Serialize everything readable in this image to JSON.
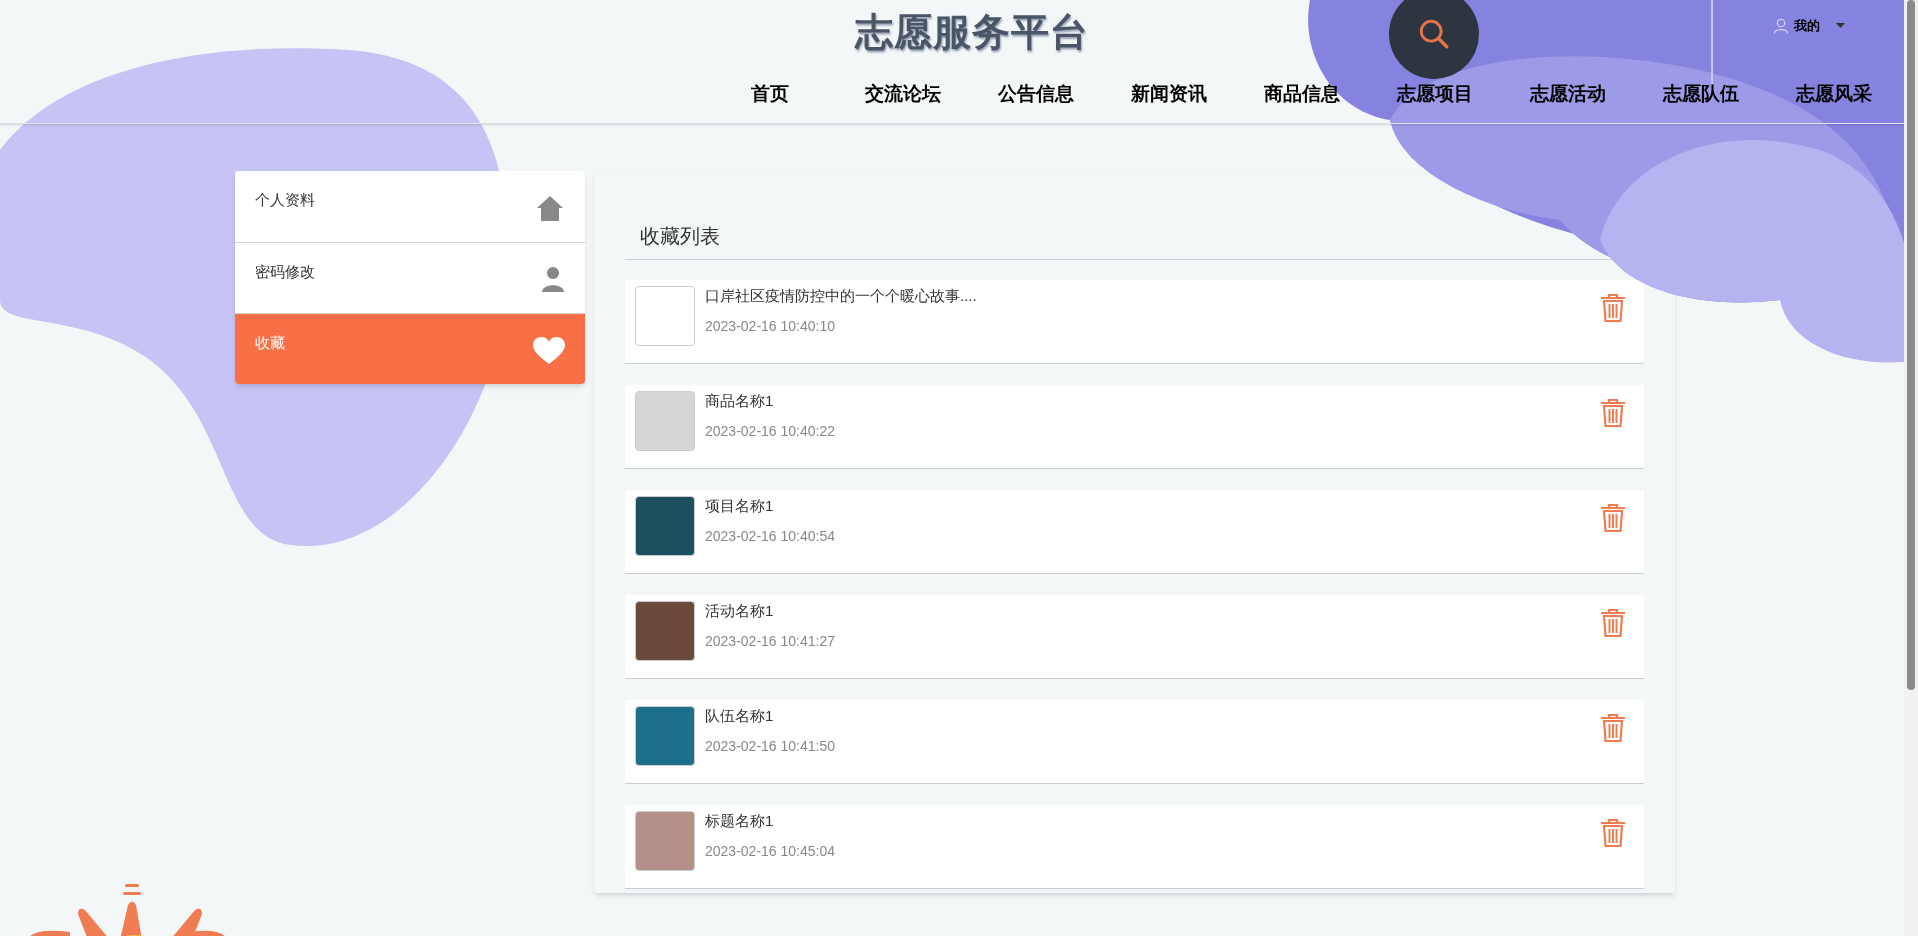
{
  "header": {
    "title": "志愿服务平台",
    "user_menu": "我的",
    "nav": [
      {
        "label": "首页",
        "selected": false
      },
      {
        "label": "交流论坛",
        "selected": false
      },
      {
        "label": "公告信息",
        "selected": false
      },
      {
        "label": "新闻资讯",
        "selected": false
      },
      {
        "label": "商品信息",
        "selected": false
      },
      {
        "label": "志愿项目",
        "selected": false
      },
      {
        "label": "志愿活动",
        "selected": false
      },
      {
        "label": "志愿队伍",
        "selected": false
      },
      {
        "label": "志愿风采",
        "selected": false
      }
    ]
  },
  "sidebar": {
    "items": [
      {
        "label": "个人资料",
        "kind": "home",
        "selected": false
      },
      {
        "label": "密码修改",
        "kind": "user",
        "selected": false
      },
      {
        "label": "收藏",
        "kind": "heart",
        "selected": true
      }
    ]
  },
  "favorites": {
    "title": "收藏列表",
    "items": [
      {
        "title": "口岸社区疫情防控中的一个个暖心故事....",
        "time": "2023-02-16 10:40:10",
        "has_image": false
      },
      {
        "title": "商品名称1",
        "time": "2023-02-16 10:40:22",
        "has_image": true
      },
      {
        "title": "项目名称1",
        "time": "2023-02-16 10:40:54",
        "has_image": true
      },
      {
        "title": "活动名称1",
        "time": "2023-02-16 10:41:27",
        "has_image": true
      },
      {
        "title": "队伍名称1",
        "time": "2023-02-16 10:41:50",
        "has_image": true
      },
      {
        "title": "标题名称1",
        "time": "2023-02-16 10:45:04",
        "has_image": true
      }
    ]
  }
}
